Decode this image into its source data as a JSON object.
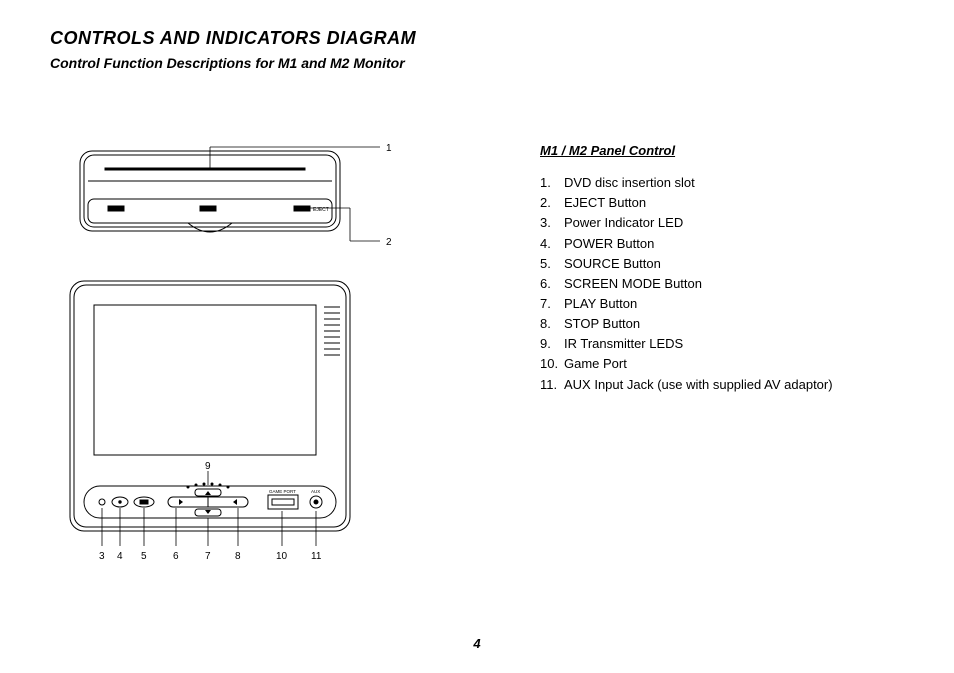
{
  "title": "CONTROLS AND INDICATORS DIAGRAM",
  "subtitle": "Control Function Descriptions for M1 and M2 Monitor",
  "legend_title": "M1 / M2 Panel Control",
  "items": [
    {
      "n": "1.",
      "t": "DVD disc insertion slot"
    },
    {
      "n": "2.",
      "t": "EJECT Button"
    },
    {
      "n": "3.",
      "t": "Power Indicator LED"
    },
    {
      "n": "4.",
      "t": "POWER Button"
    },
    {
      "n": "5.",
      "t": "SOURCE Button"
    },
    {
      "n": "6.",
      "t": "SCREEN MODE Button"
    },
    {
      "n": "7.",
      "t": "PLAY Button"
    },
    {
      "n": "8.",
      "t": "STOP Button"
    },
    {
      "n": "9.",
      "t": "IR Transmitter LEDS"
    },
    {
      "n": "10.",
      "t": "Game Port"
    },
    {
      "n": "11.",
      "t": "AUX Input Jack (use with supplied AV adaptor)"
    }
  ],
  "callouts_top": [
    "1",
    "2"
  ],
  "callouts_bottom": [
    "3",
    "4",
    "5",
    "6",
    "7",
    "8",
    "10",
    "11"
  ],
  "callout_mid": "9",
  "eject_label": "EJECT",
  "game_port_label": "GAME PORT",
  "aux_label": "AUX",
  "page_number": "4"
}
